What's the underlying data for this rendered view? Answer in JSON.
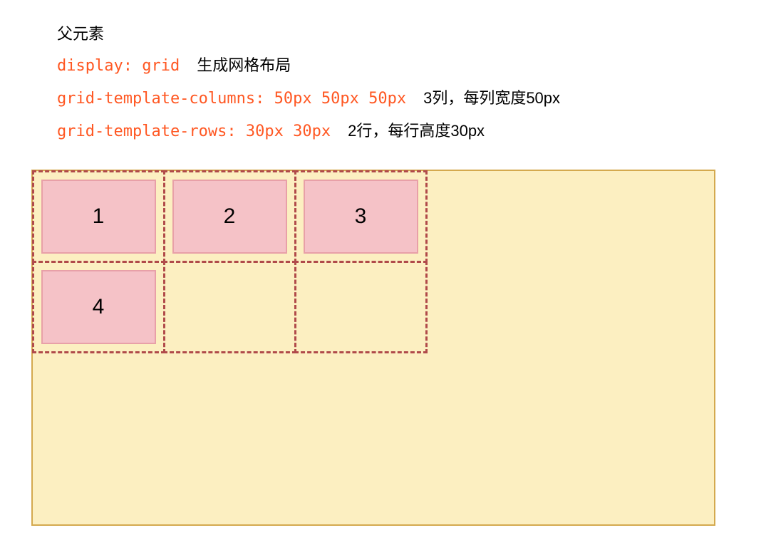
{
  "heading": "父元素",
  "lines": [
    {
      "code": "display: grid",
      "desc": "生成网格布局"
    },
    {
      "code": "grid-template-columns: 50px 50px 50px",
      "desc": "3列，每列宽度50px"
    },
    {
      "code": "grid-template-rows: 30px 30px",
      "desc": "2行，每行高度30px"
    }
  ],
  "grid": {
    "columns": 3,
    "rows": 2,
    "children": [
      "1",
      "2",
      "3",
      "4"
    ]
  },
  "colors": {
    "code": "#ff5722",
    "container_bg": "#fcefc1",
    "container_border": "#d4a94e",
    "grid_dash": "#b04a4a",
    "child_bg": "#f5c2c7",
    "child_border": "#e8a0a8"
  }
}
